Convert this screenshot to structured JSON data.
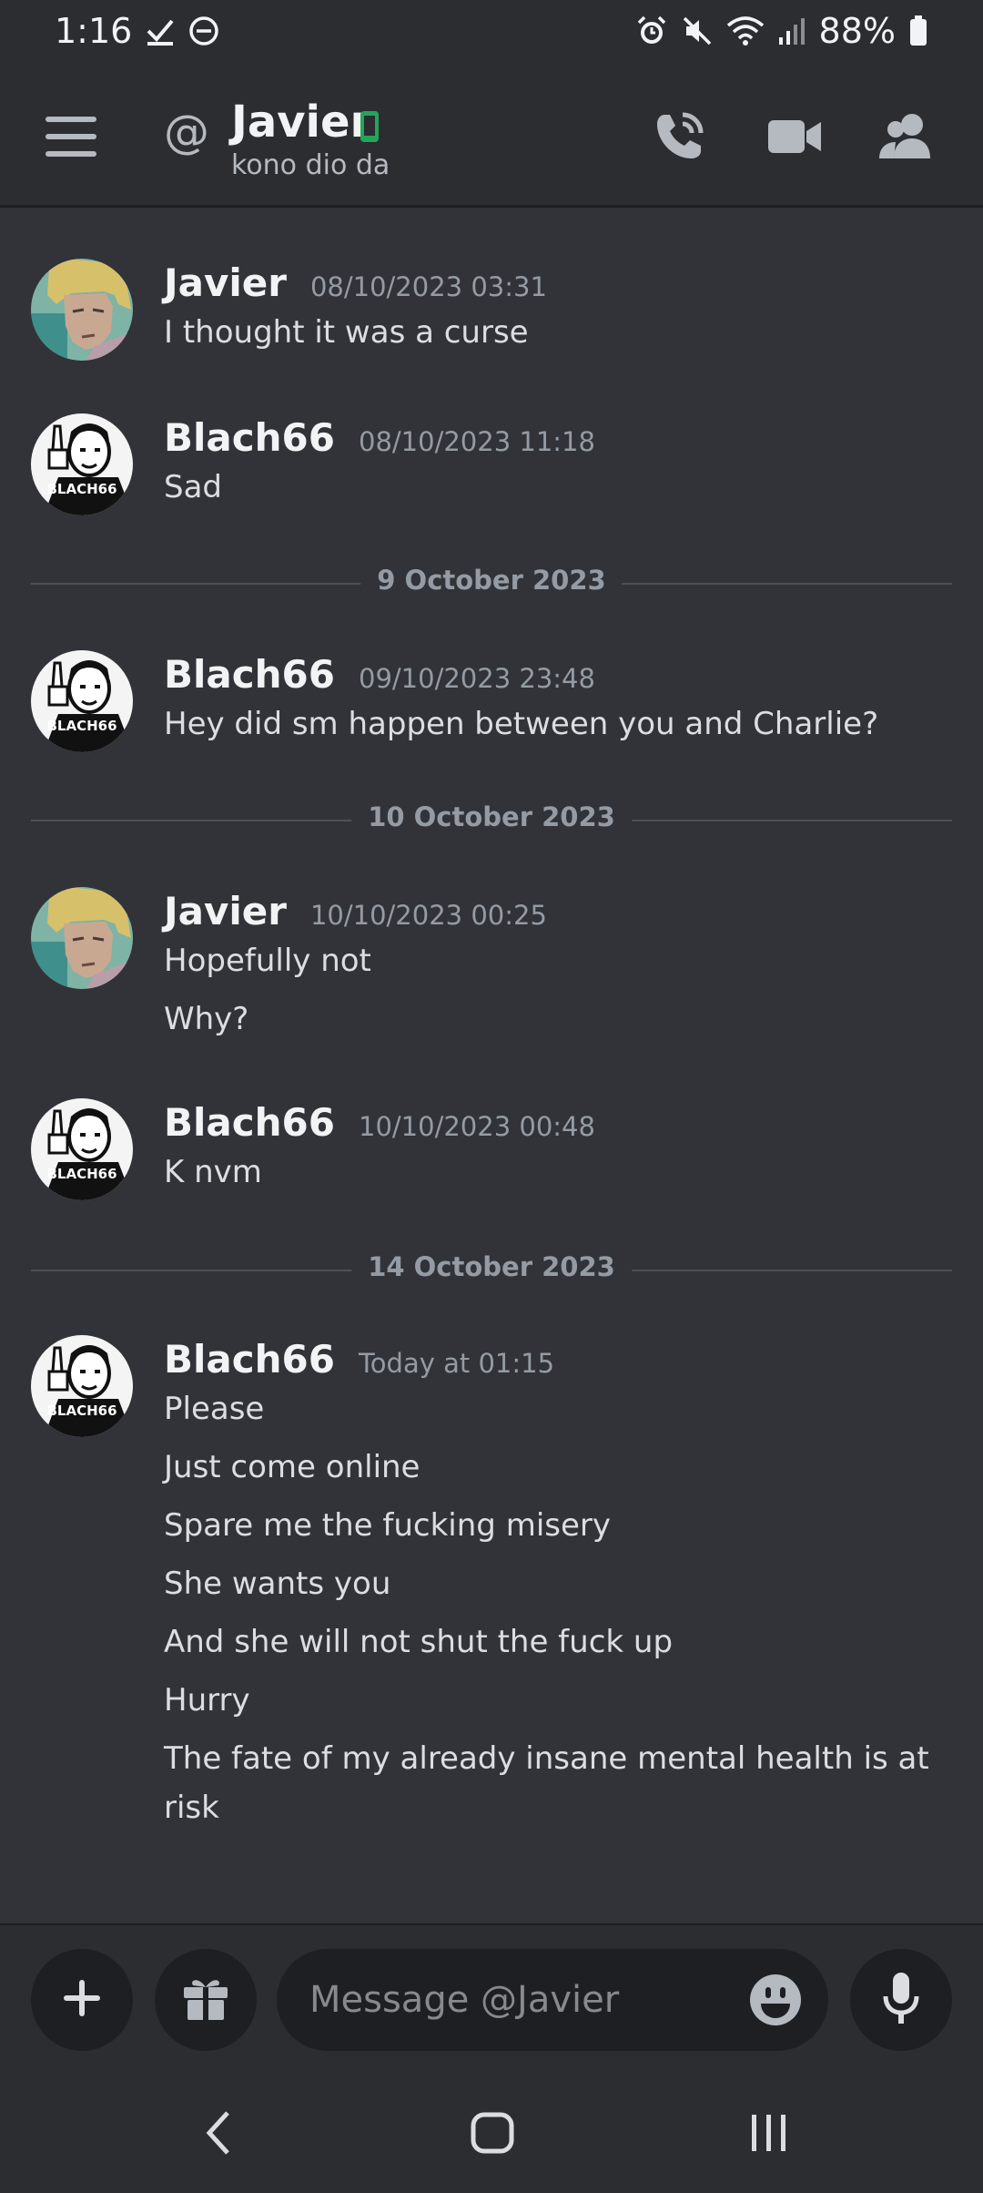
{
  "status_bar": {
    "time": "1:16",
    "battery": "88%"
  },
  "header": {
    "at_symbol": "@",
    "name": "Javier",
    "status": "kono dio da"
  },
  "messages": [
    {
      "author": "Javier",
      "timestamp": "08/10/2023 03:31",
      "lines": [
        "I thought it was a curse"
      ]
    },
    {
      "author": "Blach66",
      "timestamp": "08/10/2023 11:18",
      "lines": [
        "Sad"
      ]
    },
    {
      "author": "Blach66",
      "timestamp": "09/10/2023 23:48",
      "lines": [
        "Hey did sm happen between you and Charlie?"
      ]
    },
    {
      "author": "Javier",
      "timestamp": "10/10/2023 00:25",
      "lines": [
        "Hopefully not",
        "Why?"
      ]
    },
    {
      "author": "Blach66",
      "timestamp": "10/10/2023 00:48",
      "lines": [
        "K nvm"
      ]
    },
    {
      "author": "Blach66",
      "timestamp": "Today at 01:15",
      "lines": [
        "Please",
        "Just come online",
        "Spare me the fucking misery",
        "She wants you",
        "And she will not shut the fuck up",
        "Hurry",
        "The fate of my already insane mental health is at risk"
      ]
    }
  ],
  "dividers": [
    "9 October 2023",
    "10 October 2023",
    "14 October 2023"
  ],
  "avatar_text": "BLACH66",
  "composer": {
    "placeholder": "Message @Javier",
    "value": ""
  },
  "colors": {
    "background": "#313338",
    "header": "#2b2d31",
    "online_green": "#23a55a"
  },
  "icons": {
    "menu": "hamburger-icon",
    "call": "phone-call-icon",
    "video": "video-camera-icon",
    "members": "members-icon",
    "add": "plus-icon",
    "gift": "gift-icon",
    "emoji": "emoji-icon",
    "mic": "microphone-icon",
    "back": "back-icon",
    "home": "home-icon",
    "recents": "recents-icon"
  }
}
